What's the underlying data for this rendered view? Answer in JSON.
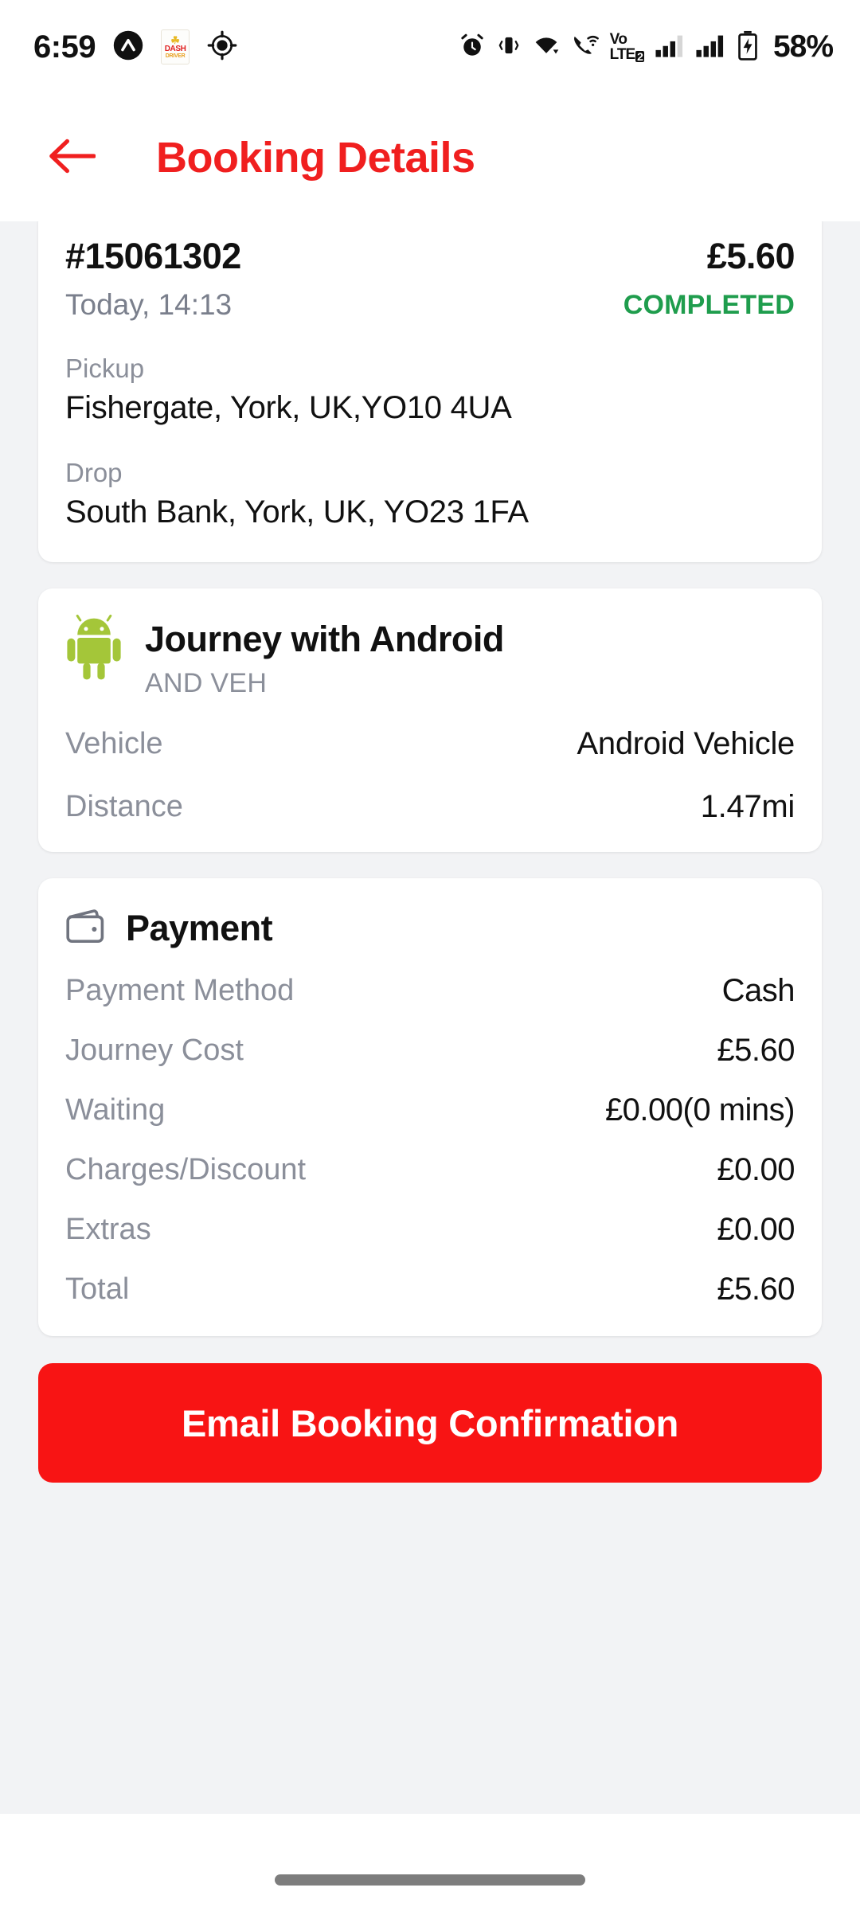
{
  "status_bar": {
    "time": "6:59",
    "battery_percent": "58%",
    "icons": [
      "app-chevron-icon",
      "dash-driver-app-icon",
      "location-crosshair-icon",
      "alarm-icon",
      "vibrate-icon",
      "wifi-icon",
      "call-wifi-icon",
      "volte-icon",
      "signal-sim1-icon",
      "signal-sim2-icon",
      "battery-charging-icon"
    ],
    "dash_badge": {
      "crown": "☘",
      "line1": "DASH",
      "line2": "DRIVER"
    },
    "volte": {
      "top": "Vo",
      "bottom": "LTE",
      "sim": "2"
    }
  },
  "app_bar": {
    "back_icon": "arrow-left-icon",
    "title": "Booking Details"
  },
  "booking": {
    "id": "#15061302",
    "fare": "£5.60",
    "date": "Today, 14:13",
    "status": "COMPLETED",
    "pickup_label": "Pickup",
    "pickup_value": "Fishergate, York, UK,YO10 4UA",
    "drop_label": "Drop",
    "drop_value": "South Bank, York, UK, YO23 1FA"
  },
  "journey": {
    "icon": "android-robot-icon",
    "title": "Journey with Android",
    "subtitle": "AND VEH",
    "rows": [
      {
        "key": "Vehicle",
        "value": "Android Vehicle"
      },
      {
        "key": "Distance",
        "value": "1.47mi"
      }
    ]
  },
  "payment": {
    "icon": "wallet-icon",
    "title": "Payment",
    "rows": [
      {
        "key": "Payment Method",
        "value": "Cash"
      },
      {
        "key": "Journey Cost",
        "value": "£5.60"
      },
      {
        "key": "Waiting",
        "value": "£0.00(0 mins)"
      },
      {
        "key": "Charges/Discount",
        "value": "£0.00"
      },
      {
        "key": "Extras",
        "value": "£0.00"
      },
      {
        "key": "Total",
        "value": "£5.60"
      }
    ]
  },
  "cta": {
    "label": "Email Booking Confirmation"
  },
  "colors": {
    "brand_red": "#f01f1f",
    "button_red": "#f81414",
    "status_green": "#1f9d4d",
    "android_green": "#a4c639",
    "page_bg": "#f2f3f5",
    "muted_text": "#8b8f9a"
  }
}
